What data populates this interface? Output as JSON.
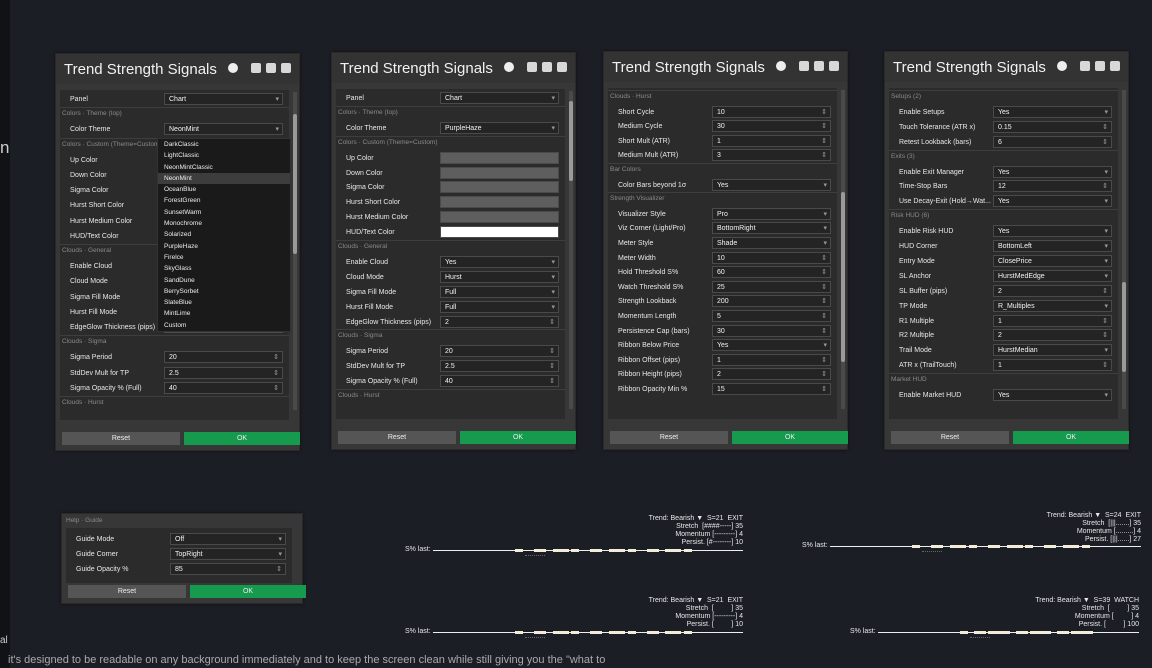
{
  "panels": [
    {
      "title": "Trend Strength Signals",
      "rows": [
        {
          "t": "row",
          "label": "Panel",
          "value": "Chart",
          "kind": "dd"
        },
        {
          "t": "sec",
          "label": "Colors · Theme (top)"
        },
        {
          "t": "row",
          "label": "Color Theme",
          "value": "NeonMint",
          "kind": "dd"
        },
        {
          "t": "sec",
          "label": "Colors · Custom (Theme=Custom)"
        },
        {
          "t": "row",
          "label": "Up Color",
          "value": "",
          "kind": "sw"
        },
        {
          "t": "row",
          "label": "Down Color",
          "value": "",
          "kind": "sw"
        },
        {
          "t": "row",
          "label": "Sigma Color",
          "value": "",
          "kind": "sw"
        },
        {
          "t": "row",
          "label": "Hurst Short Color",
          "value": "",
          "kind": "sw"
        },
        {
          "t": "row",
          "label": "Hurst Medium Color",
          "value": "",
          "kind": "sw"
        },
        {
          "t": "row",
          "label": "HUD/Text Color",
          "value": "",
          "kind": "sw"
        },
        {
          "t": "sec",
          "label": "Clouds · General"
        },
        {
          "t": "row",
          "label": "Enable Cloud",
          "value": "",
          "kind": "dd"
        },
        {
          "t": "row",
          "label": "Cloud Mode",
          "value": "",
          "kind": "dd"
        },
        {
          "t": "row",
          "label": "Sigma Fill Mode",
          "value": "",
          "kind": "dd"
        },
        {
          "t": "row",
          "label": "Hurst Fill Mode",
          "value": "",
          "kind": "dd"
        },
        {
          "t": "row",
          "label": "EdgeGlow Thickness (pips)",
          "value": "",
          "kind": "sp"
        },
        {
          "t": "sec",
          "label": "Clouds · Sigma"
        },
        {
          "t": "row",
          "label": "Sigma Period",
          "value": "20",
          "kind": "sp"
        },
        {
          "t": "row",
          "label": "StdDev Mult for TP",
          "value": "2.5",
          "kind": "sp"
        },
        {
          "t": "row",
          "label": "Sigma Opacity % (Full)",
          "value": "40",
          "kind": "sp"
        },
        {
          "t": "sec",
          "label": "Clouds · Hurst"
        }
      ]
    },
    {
      "title": "Trend Strength Signals",
      "rows": [
        {
          "t": "row",
          "label": "Panel",
          "value": "Chart",
          "kind": "dd"
        },
        {
          "t": "sec",
          "label": "Colors · Theme (top)"
        },
        {
          "t": "row",
          "label": "Color Theme",
          "value": "PurpleHaze",
          "kind": "dd"
        },
        {
          "t": "sec",
          "label": "Colors · Custom (Theme=Custom)"
        },
        {
          "t": "row",
          "label": "Up Color",
          "value": "",
          "kind": "sw"
        },
        {
          "t": "row",
          "label": "Down Color",
          "value": "",
          "kind": "sw"
        },
        {
          "t": "row",
          "label": "Sigma Color",
          "value": "",
          "kind": "sw"
        },
        {
          "t": "row",
          "label": "Hurst Short Color",
          "value": "",
          "kind": "sw"
        },
        {
          "t": "row",
          "label": "Hurst Medium Color",
          "value": "",
          "kind": "sw"
        },
        {
          "t": "row",
          "label": "HUD/Text Color",
          "value": "",
          "kind": "sw w"
        },
        {
          "t": "sec",
          "label": "Clouds · General"
        },
        {
          "t": "row",
          "label": "Enable Cloud",
          "value": "Yes",
          "kind": "dd"
        },
        {
          "t": "row",
          "label": "Cloud Mode",
          "value": "Hurst",
          "kind": "dd"
        },
        {
          "t": "row",
          "label": "Sigma Fill Mode",
          "value": "Full",
          "kind": "dd"
        },
        {
          "t": "row",
          "label": "Hurst Fill Mode",
          "value": "Full",
          "kind": "dd"
        },
        {
          "t": "row",
          "label": "EdgeGlow Thickness (pips)",
          "value": "2",
          "kind": "sp"
        },
        {
          "t": "sec",
          "label": "Clouds · Sigma"
        },
        {
          "t": "row",
          "label": "Sigma Period",
          "value": "20",
          "kind": "sp"
        },
        {
          "t": "row",
          "label": "StdDev Mult for TP",
          "value": "2.5",
          "kind": "sp"
        },
        {
          "t": "row",
          "label": "Sigma Opacity % (Full)",
          "value": "40",
          "kind": "sp"
        },
        {
          "t": "sec",
          "label": "Clouds · Hurst"
        }
      ]
    },
    {
      "title": "Trend Strength Signals",
      "rows": [
        {
          "t": "sec",
          "label": "Clouds · Hurst"
        },
        {
          "t": "row",
          "label": "Short Cycle",
          "value": "10",
          "kind": "sp"
        },
        {
          "t": "row",
          "label": "Medium Cycle",
          "value": "30",
          "kind": "sp"
        },
        {
          "t": "row",
          "label": "Short Mult (ATR)",
          "value": "1",
          "kind": "sp"
        },
        {
          "t": "row",
          "label": "Medium Mult (ATR)",
          "value": "3",
          "kind": "sp"
        },
        {
          "t": "sec",
          "label": "Bar Colors"
        },
        {
          "t": "row",
          "label": "Color Bars beyond 1σ",
          "value": "Yes",
          "kind": "dd"
        },
        {
          "t": "sec",
          "label": "Strength Visualizer"
        },
        {
          "t": "row",
          "label": "Visualizer Style",
          "value": "Pro",
          "kind": "dd"
        },
        {
          "t": "row",
          "label": "Viz Corner (Light/Pro)",
          "value": "BottomRight",
          "kind": "dd"
        },
        {
          "t": "row",
          "label": "Meter Style",
          "value": "Shade",
          "kind": "dd"
        },
        {
          "t": "row",
          "label": "Meter Width",
          "value": "10",
          "kind": "sp"
        },
        {
          "t": "row",
          "label": "Hold Threshold S%",
          "value": "60",
          "kind": "sp"
        },
        {
          "t": "row",
          "label": "Watch Threshold S%",
          "value": "25",
          "kind": "sp"
        },
        {
          "t": "row",
          "label": "Strength Lookback",
          "value": "200",
          "kind": "sp"
        },
        {
          "t": "row",
          "label": "Momentum Length",
          "value": "5",
          "kind": "sp"
        },
        {
          "t": "row",
          "label": "Persistence Cap (bars)",
          "value": "30",
          "kind": "sp"
        },
        {
          "t": "row",
          "label": "Ribbon Below Price",
          "value": "Yes",
          "kind": "dd"
        },
        {
          "t": "row",
          "label": "Ribbon Offset (pips)",
          "value": "1",
          "kind": "sp"
        },
        {
          "t": "row",
          "label": "Ribbon Height (pips)",
          "value": "2",
          "kind": "sp"
        },
        {
          "t": "row",
          "label": "Ribbon Opacity Min %",
          "value": "15",
          "kind": "sp"
        }
      ]
    },
    {
      "title": "Trend Strength Signals",
      "rows": [
        {
          "t": "sec",
          "label": "Setups (2)"
        },
        {
          "t": "row",
          "label": "Enable Setups",
          "value": "Yes",
          "kind": "dd"
        },
        {
          "t": "row",
          "label": "Touch Tolerance (ATR x)",
          "value": "0.15",
          "kind": "sp"
        },
        {
          "t": "row",
          "label": "Retest Lookback (bars)",
          "value": "6",
          "kind": "sp"
        },
        {
          "t": "sec",
          "label": "Exits (3)"
        },
        {
          "t": "row",
          "label": "Enable Exit Manager",
          "value": "Yes",
          "kind": "dd"
        },
        {
          "t": "row",
          "label": "Time-Stop Bars",
          "value": "12",
          "kind": "sp"
        },
        {
          "t": "row",
          "label": "Use Decay-Exit (Hold→Wat...",
          "value": "Yes",
          "kind": "dd"
        },
        {
          "t": "sec",
          "label": "Risk HUD (6)"
        },
        {
          "t": "row",
          "label": "Enable Risk HUD",
          "value": "Yes",
          "kind": "dd"
        },
        {
          "t": "row",
          "label": "HUD Corner",
          "value": "BottomLeft",
          "kind": "dd"
        },
        {
          "t": "row",
          "label": "Entry Mode",
          "value": "ClosePrice",
          "kind": "dd"
        },
        {
          "t": "row",
          "label": "SL Anchor",
          "value": "HurstMedEdge",
          "kind": "dd"
        },
        {
          "t": "row",
          "label": "SL Buffer (pips)",
          "value": "2",
          "kind": "sp"
        },
        {
          "t": "row",
          "label": "TP Mode",
          "value": "R_Multiples",
          "kind": "dd"
        },
        {
          "t": "row",
          "label": "R1 Multiple",
          "value": "1",
          "kind": "sp"
        },
        {
          "t": "row",
          "label": "R2 Multiple",
          "value": "2",
          "kind": "sp"
        },
        {
          "t": "row",
          "label": "Trail Mode",
          "value": "HurstMedian",
          "kind": "dd"
        },
        {
          "t": "row",
          "label": "ATR x (TrailTouch)",
          "value": "1",
          "kind": "sp"
        },
        {
          "t": "sec",
          "label": "Market HUD"
        },
        {
          "t": "row",
          "label": "Enable Market HUD",
          "value": "Yes",
          "kind": "dd"
        }
      ]
    }
  ],
  "buttons": {
    "reset": "Reset",
    "ok": "OK"
  },
  "theme_menu": [
    "DarkClassic",
    "LightClassic",
    "NeonMintClassic",
    "NeonMint",
    "OceanBlue",
    "ForestGreen",
    "SunsetWarm",
    "Monochrome",
    "Solarized",
    "PurpleHaze",
    "Firelce",
    "SkyGlass",
    "SandDune",
    "BerrySorbet",
    "SlateBlue",
    "MintLime",
    "Custom"
  ],
  "theme_menu_selected": "NeonMint",
  "guide": {
    "header": "Help · Guide",
    "rows": [
      {
        "label": "Guide Mode",
        "value": "Off",
        "kind": "dd"
      },
      {
        "label": "Guide Corner",
        "value": "TopRight",
        "kind": "dd"
      },
      {
        "label": "Guide Opacity %",
        "value": "85",
        "kind": "sp"
      }
    ]
  },
  "huds": [
    {
      "lines": [
        "Trend: Bearish ▼  S=21  EXIT",
        "Stretch  [####-----] 35",
        "Momentum [---------] 4",
        "Persist. [#--------] 10"
      ],
      "label": "S% last:"
    },
    {
      "lines": [
        "Trend: Bearish ▼  S=24  EXIT",
        "Stretch  [|||.......] 35",
        "Momentum [.........] 4",
        "Persist. [|||......] 27"
      ],
      "label": "S% last:"
    },
    {
      "lines": [
        "Trend: Bearish ▼  S=21  EXIT",
        "Stretch  [         ] 35",
        "Momentum [---------] 4",
        "Persist. [         ] 10"
      ],
      "label": "S% last:"
    },
    {
      "lines": [
        "Trend: Bearish ▼  S=39  WATCH",
        "Stretch  [         ] 35",
        "Momentum [         ] 4",
        "Persist. [         ] 100"
      ],
      "label": "S% last:"
    }
  ],
  "left_edge": {
    "glyph": "n",
    "word": "al"
  },
  "bottom_text": "it's designed to be readable on any background immediately and to keep the screen clean while still giving you the \"what to"
}
